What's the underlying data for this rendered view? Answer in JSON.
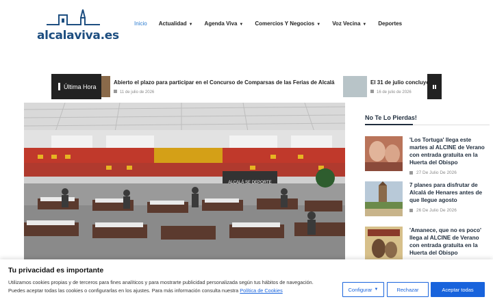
{
  "header": {
    "logo_text": "alcalaviva.es",
    "nav": [
      {
        "label": "Inicio",
        "active": true,
        "has_dropdown": false
      },
      {
        "label": "Actualidad",
        "active": false,
        "has_dropdown": true
      },
      {
        "label": "Agenda Viva",
        "active": false,
        "has_dropdown": true
      },
      {
        "label": "Comercios Y Negocios",
        "active": false,
        "has_dropdown": true
      },
      {
        "label": "Voz Vecina",
        "active": false,
        "has_dropdown": true
      },
      {
        "label": "Deportes",
        "active": false,
        "has_dropdown": false
      }
    ],
    "dropdown_icon": "chevron-down-icon"
  },
  "ticker": {
    "label": "Última Hora",
    "items": [
      {
        "title": "Abierto el plazo para participar en el Concurso de Comparsas de las Ferias de Alcalá",
        "date": "11 de julio de 2026"
      },
      {
        "title": "El 31 de julio concluye",
        "date": "16 de julio de 2026"
      }
    ],
    "pause_icon": "pause-icon"
  },
  "sidebar": {
    "title": "No Te Lo Pierdas!",
    "items": [
      {
        "title": "'Los Tortuga' llega este martes al ALCINE de Verano con entrada gratuita en la Huerta del Obispo",
        "date": "27 De Julio De 2026"
      },
      {
        "title": "7 planes para disfrutar de Alcalá de Henares antes de que llegue agosto",
        "date": "26 De Julio De 2026"
      },
      {
        "title": "'Amanece, que no es poco' llega al ALCINE de Verano con entrada gratuita en la Huerta del Obispo",
        "date": ""
      }
    ]
  },
  "hero": {
    "banner_text": "ALCALÁ SE DEPORTE"
  },
  "cookie": {
    "title": "Tu privacidad es importante",
    "body_1": "Utilizamos cookies propias y de terceros para fines analíticos y para mostrarte publicidad personalizada según tus hábitos de navegación.",
    "body_2": "Puedes aceptar todas las cookies o configurarlas en los ajustes. Para más información consulta nuestra",
    "policy_link": "Política de Cookies",
    "btn_config": "Configurar",
    "btn_reject": "Rechazar",
    "btn_accept": "Aceptar todas"
  },
  "colors": {
    "accent": "#1863dc",
    "nav_active": "#2b7bd0",
    "logo": "#1d4e80",
    "ticker_bg": "#222222"
  }
}
